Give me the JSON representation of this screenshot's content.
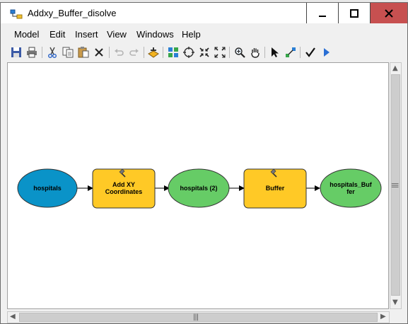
{
  "window": {
    "title": "Addxy_Buffer_disolve"
  },
  "controls": {
    "minimize": "—",
    "maximize": "☐",
    "close": "✕"
  },
  "menu": [
    "Model",
    "Edit",
    "Insert",
    "View",
    "Windows",
    "Help"
  ],
  "toolbar": [
    "save-icon",
    "print-icon",
    "cut-icon",
    "copy-icon",
    "paste-icon",
    "delete-icon",
    "undo-icon",
    "redo-icon",
    "add-data-icon",
    "auto-layout-icon",
    "full-extent-icon",
    "zoom-in-fixed-icon",
    "zoom-out-fixed-icon",
    "zoom-icon",
    "pan-icon",
    "select-icon",
    "connect-icon",
    "validate-icon",
    "run-icon"
  ],
  "model": {
    "nodes": [
      {
        "label": "hospitals",
        "kind": "input-data",
        "color": "#0a93c8"
      },
      {
        "label": "Add XY Coordinates",
        "kind": "tool",
        "color": "#ffc926"
      },
      {
        "label": "hospitals (2)",
        "kind": "derived-data",
        "color": "#66cc66"
      },
      {
        "label": "Buffer",
        "kind": "tool",
        "color": "#ffc926"
      },
      {
        "label": "hospitals_Buffer",
        "kind": "derived-data",
        "color": "#66cc66"
      }
    ],
    "line1": {
      "hospitals_Buffer_a": "hospitals_Buf",
      "hospitals_Buffer_b": "fer"
    },
    "add_xy_a": "Add XY",
    "add_xy_b": "Coordinates"
  },
  "scroll": {
    "grip": "|||",
    "grip_h": "|||"
  }
}
